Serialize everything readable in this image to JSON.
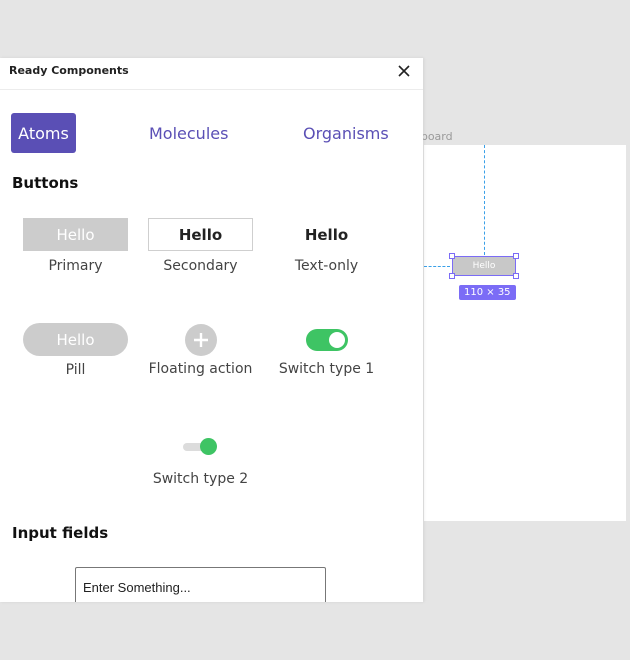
{
  "panel": {
    "title": "Ready Components"
  },
  "tabs": [
    {
      "label": "Atoms",
      "active": true
    },
    {
      "label": "Molecules",
      "active": false
    },
    {
      "label": "Organisms",
      "active": false
    }
  ],
  "sections": {
    "buttons_title": "Buttons",
    "input_fields_title": "Input fields"
  },
  "buttons": {
    "primary": {
      "text": "Hello",
      "label": "Primary"
    },
    "secondary": {
      "text": "Hello",
      "label": "Secondary"
    },
    "text_only": {
      "text": "Hello",
      "label": "Text-only"
    },
    "pill": {
      "text": "Hello",
      "label": "Pill"
    },
    "floating": {
      "label": "Floating action",
      "icon": "plus-icon"
    },
    "switch1": {
      "label": "Switch type 1",
      "on": true
    },
    "switch2": {
      "label": "Switch type 2",
      "on": true
    }
  },
  "input": {
    "value": "Enter Something..."
  },
  "canvas": {
    "artboard_label": "rtboard",
    "selected_button_text": "Hello",
    "size_badge": "110 × 35"
  },
  "colors": {
    "accent": "#5a4fb5",
    "selection": "#7b6cf6",
    "switch_on": "#3ec464",
    "button_gray": "#cccccc"
  }
}
